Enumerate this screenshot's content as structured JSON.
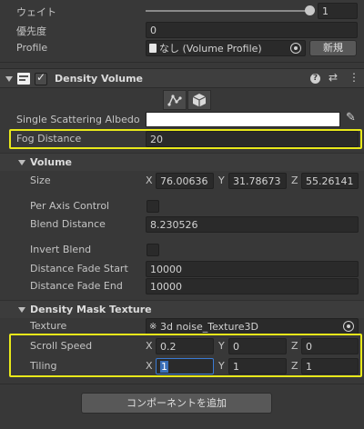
{
  "top": {
    "weight_label": "ウェイト",
    "weight_value": "1",
    "priority_label": "優先度",
    "priority_value": "0",
    "profile_label": "Profile",
    "profile_value": "なし (Volume Profile)",
    "new_button": "新規"
  },
  "component": {
    "title": "Density Volume",
    "enabled": true
  },
  "fields": {
    "albedo_label": "Single Scattering Albedo",
    "albedo_color": "#ffffff",
    "fog_distance_label": "Fog Distance",
    "fog_distance_value": "20"
  },
  "volume": {
    "header": "Volume",
    "size_label": "Size",
    "size_x": "76.00636",
    "size_y": "31.78673",
    "size_z": "55.26141",
    "per_axis_label": "Per Axis Control",
    "blend_label": "Blend Distance",
    "blend_value": "8.230526",
    "invert_label": "Invert Blend",
    "fade_start_label": "Distance Fade Start",
    "fade_start_value": "10000",
    "fade_end_label": "Distance Fade End",
    "fade_end_value": "10000"
  },
  "mask": {
    "header": "Density Mask Texture",
    "texture_label": "Texture",
    "texture_value": "3d noise_Texture3D",
    "scroll_label": "Scroll Speed",
    "scroll_x": "0.2",
    "scroll_y": "0",
    "scroll_z": "0",
    "tiling_label": "Tiling",
    "tiling_x": "1",
    "tiling_y": "1",
    "tiling_z": "1"
  },
  "axes": {
    "x": "X",
    "y": "Y",
    "z": "Z"
  },
  "add_component": "コンポーネントを追加",
  "colors": {
    "highlight": "#e8e81a",
    "background": "#383838"
  }
}
